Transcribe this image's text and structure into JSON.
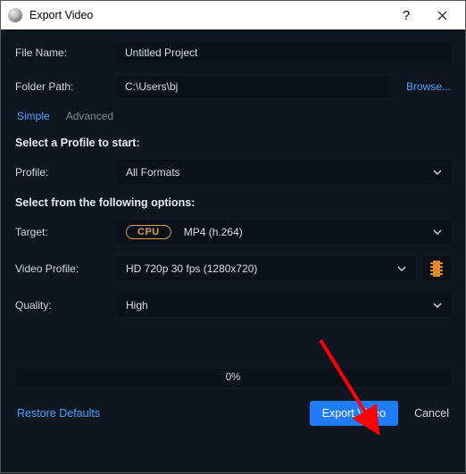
{
  "window": {
    "title": "Export Video"
  },
  "fields": {
    "file_name_label": "File Name:",
    "file_name_value": "Untitled Project",
    "folder_path_label": "Folder Path:",
    "folder_path_value": "C:\\Users\\bj",
    "browse_link": "Browse..."
  },
  "tabs": {
    "simple": "Simple",
    "advanced": "Advanced"
  },
  "sections": {
    "profile_heading": "Select a Profile to start:",
    "profile_label": "Profile:",
    "profile_value": "All Formats",
    "options_heading": "Select from the following options:",
    "target_label": "Target:",
    "target_badge": "CPU",
    "target_value": "MP4 (h.264)",
    "video_profile_label": "Video Profile:",
    "video_profile_value": "HD 720p 30 fps (1280x720)",
    "quality_label": "Quality:",
    "quality_value": "High"
  },
  "progress": {
    "text": "0%"
  },
  "footer": {
    "restore": "Restore Defaults",
    "export": "Export Video",
    "cancel": "Cancel"
  }
}
